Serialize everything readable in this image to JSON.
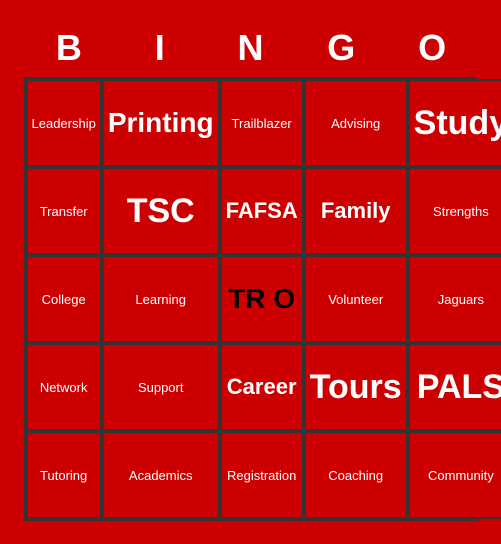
{
  "header": {
    "letters": [
      "B",
      "I",
      "N",
      "G",
      "O"
    ]
  },
  "grid": [
    [
      {
        "text": "Leadership",
        "size": "cell-text"
      },
      {
        "text": "Printing",
        "size": "cell-text large"
      },
      {
        "text": "Trailblazer",
        "size": "cell-text"
      },
      {
        "text": "Advising",
        "size": "cell-text"
      },
      {
        "text": "Study",
        "size": "cell-text xlarge"
      }
    ],
    [
      {
        "text": "Transfer",
        "size": "cell-text"
      },
      {
        "text": "TSC",
        "size": "cell-text xlarge"
      },
      {
        "text": "FAFSA",
        "size": "cell-text medium"
      },
      {
        "text": "Family",
        "size": "cell-text medium"
      },
      {
        "text": "Strengths",
        "size": "cell-text"
      }
    ],
    [
      {
        "text": "College",
        "size": "cell-text"
      },
      {
        "text": "Learning",
        "size": "cell-text"
      },
      {
        "text": "TRIO",
        "size": "trio"
      },
      {
        "text": "Volunteer",
        "size": "cell-text"
      },
      {
        "text": "Jaguars",
        "size": "cell-text"
      }
    ],
    [
      {
        "text": "Network",
        "size": "cell-text"
      },
      {
        "text": "Support",
        "size": "cell-text"
      },
      {
        "text": "Career",
        "size": "cell-text medium"
      },
      {
        "text": "Tours",
        "size": "cell-text xlarge"
      },
      {
        "text": "PALS",
        "size": "cell-text xlarge"
      }
    ],
    [
      {
        "text": "Tutoring",
        "size": "cell-text"
      },
      {
        "text": "Academics",
        "size": "cell-text"
      },
      {
        "text": "Registration",
        "size": "cell-text"
      },
      {
        "text": "Coaching",
        "size": "cell-text"
      },
      {
        "text": "Community",
        "size": "cell-text"
      }
    ]
  ]
}
